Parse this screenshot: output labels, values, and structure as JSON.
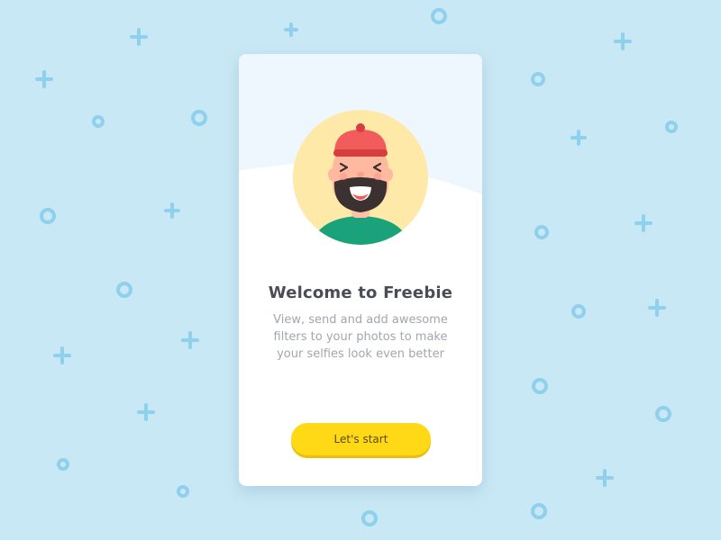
{
  "welcome": {
    "title": "Welcome to Freebie",
    "description": "View, send and add awesome filters to your photos to make your selfies look even better",
    "start_button_label": "Let's start"
  },
  "icons": {
    "avatar": "bearded-man-avatar-icon",
    "plus": "plus-icon",
    "circle": "circle-icon"
  },
  "colors": {
    "background": "#c9e8f5",
    "decoration": "#8fd0ec",
    "card": "#ffffff",
    "card_header": "#eef7fd",
    "button": "#ffd816",
    "title": "#4a4d57",
    "description": "#a3a6ae"
  }
}
